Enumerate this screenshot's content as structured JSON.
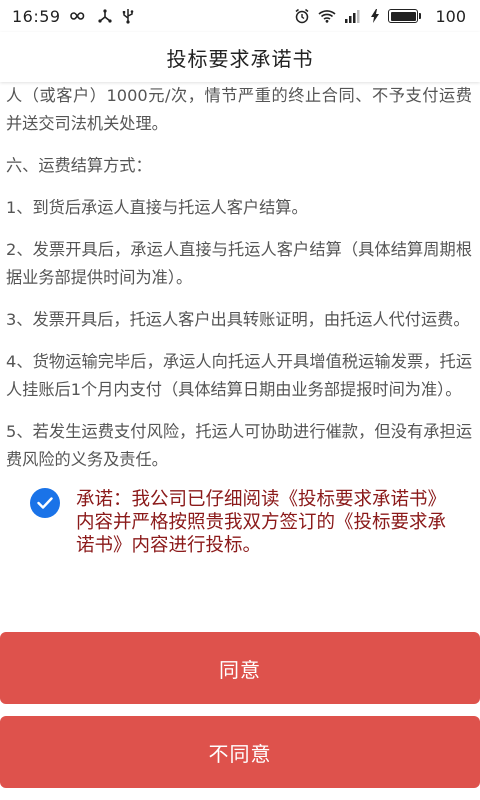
{
  "status_bar": {
    "time": "16:59",
    "left_icons": [
      "infinity-icon",
      "share-icon",
      "usb-icon"
    ],
    "right_icons": [
      "alarm-icon",
      "wifi-icon",
      "signal-icon",
      "charging-icon"
    ],
    "battery_percent": "100",
    "battery_level": 1.0
  },
  "nav": {
    "title": "投标要求承诺书"
  },
  "content": {
    "paragraphs": [
      "人（或客户）1000元/次，情节严重的终止合同、不予支付运费并送交司法机关处理。",
      "六、运费结算方式：",
      "1、到货后承运人直接与托运人客户结算。",
      "2、发票开具后，承运人直接与托运人客户结算（具体结算周期根据业务部提供时间为准）。",
      "3、发票开具后，托运人客户出具转账证明，由托运人代付运费。",
      "4、货物运输完毕后，承运人向托运人开具增值税运输发票，托运人挂账后1个月内支付（具体结算日期由业务部提报时间为准）。",
      "5、若发生运费支付风险，托运人可协助进行催款，但没有承担运费风险的义务及责任。"
    ],
    "commitment": "承诺：我公司已仔细阅读《投标要求承诺书》内容并严格按照贵我双方签订的《投标要求承诺书》内容进行投标。",
    "commitment_checked": true
  },
  "buttons": {
    "agree_label": "同意",
    "disagree_label": "不同意"
  },
  "colors": {
    "button_bg": "#de524c",
    "checkbox_bg": "#1a73e8",
    "commitment_text": "#8b1a1a",
    "body_text": "#555555"
  }
}
